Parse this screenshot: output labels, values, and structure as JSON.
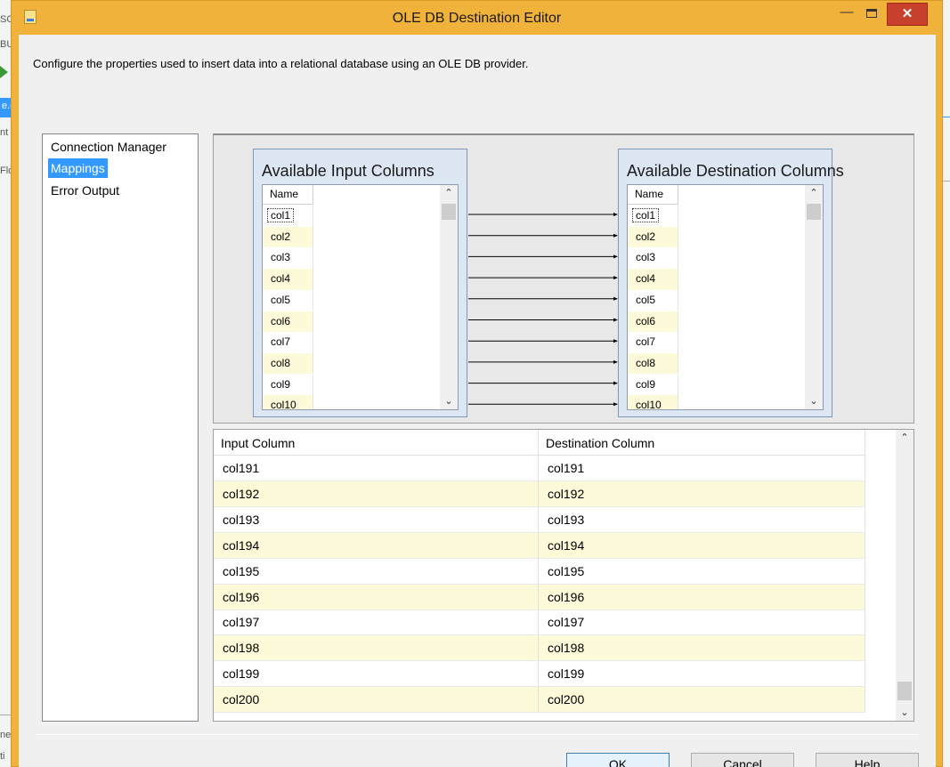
{
  "window": {
    "title": "OLE DB Destination Editor",
    "minimize_glyph": "—",
    "close_glyph": "✕"
  },
  "subtitle": "Configure the properties used to insert data into a relational database using an OLE DB provider.",
  "nav": {
    "items": [
      {
        "label": "Connection Manager",
        "selected": false
      },
      {
        "label": "Mappings",
        "selected": true
      },
      {
        "label": "Error Output",
        "selected": false
      }
    ]
  },
  "mapping": {
    "input_title": "Available Input Columns",
    "dest_title": "Available Destination Columns",
    "name_header": "Name",
    "input_columns": [
      "col1",
      "col2",
      "col3",
      "col4",
      "col5",
      "col6",
      "col7",
      "col8",
      "col9",
      "col10"
    ],
    "dest_columns": [
      "col1",
      "col2",
      "col3",
      "col4",
      "col5",
      "col6",
      "col7",
      "col8",
      "col9",
      "col10"
    ],
    "scroll_up": "⌃",
    "scroll_down": "⌄"
  },
  "grid": {
    "headers": {
      "input": "Input Column",
      "dest": "Destination Column"
    },
    "rows": [
      {
        "input": "col191",
        "dest": "col191"
      },
      {
        "input": "col192",
        "dest": "col192"
      },
      {
        "input": "col193",
        "dest": "col193"
      },
      {
        "input": "col194",
        "dest": "col194"
      },
      {
        "input": "col195",
        "dest": "col195"
      },
      {
        "input": "col196",
        "dest": "col196"
      },
      {
        "input": "col197",
        "dest": "col197"
      },
      {
        "input": "col198",
        "dest": "col198"
      },
      {
        "input": "col199",
        "dest": "col199"
      },
      {
        "input": "col200",
        "dest": "col200"
      }
    ]
  },
  "buttons": {
    "ok": "OK",
    "cancel": "Cancel",
    "help": "Help"
  },
  "background": {
    "fragments": [
      "SC",
      "BU",
      "e.c",
      "nt",
      "Flo",
      "ne",
      "ti"
    ]
  },
  "colors": {
    "title_bar": "#f0b23a",
    "selection": "#3399ff",
    "alt_row": "#fcfad8",
    "close_button": "#c7402c"
  }
}
